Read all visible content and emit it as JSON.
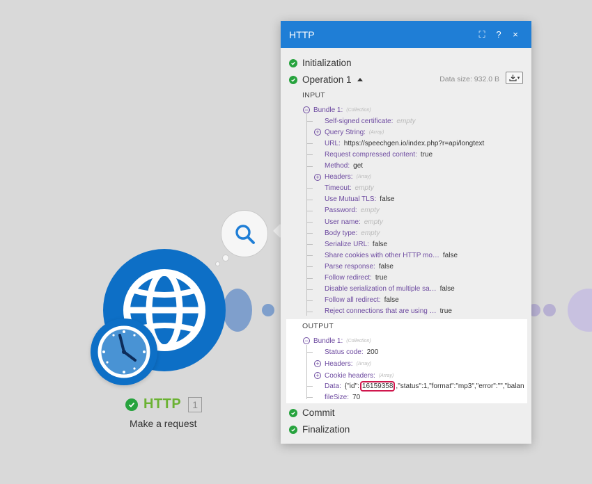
{
  "node": {
    "title": "HTTP",
    "number": "1",
    "subtitle": "Make a request"
  },
  "panel": {
    "title": "HTTP",
    "header_buttons": {
      "expand": "⛶",
      "help": "?",
      "close": "×"
    },
    "stages": {
      "initialization": "Initialization",
      "operation": "Operation 1",
      "commit": "Commit",
      "finalization": "Finalization"
    },
    "data_size": "Data size: 932.0 B",
    "input_label": "INPUT",
    "output_label": "OUTPUT",
    "input": {
      "bundle_key": "Bundle 1:",
      "bundle_type": "(Collection)",
      "rows": [
        {
          "key": "Self-signed certificate:",
          "value": "empty",
          "style": "e"
        },
        {
          "key": "Query String:",
          "value": "(Array)",
          "style": "t",
          "toggle": "+"
        },
        {
          "key": "URL:",
          "value": "https://speechgen.io/index.php?r=api/longtext",
          "style": "v"
        },
        {
          "key": "Request compressed content:",
          "value": "true",
          "style": "v"
        },
        {
          "key": "Method:",
          "value": "get",
          "style": "v"
        },
        {
          "key": "Headers:",
          "value": "(Array)",
          "style": "t",
          "toggle": "+"
        },
        {
          "key": "Timeout:",
          "value": "empty",
          "style": "e"
        },
        {
          "key": "Use Mutual TLS:",
          "value": "false",
          "style": "v"
        },
        {
          "key": "Password:",
          "value": "empty",
          "style": "e"
        },
        {
          "key": "User name:",
          "value": "empty",
          "style": "e"
        },
        {
          "key": "Body type:",
          "value": "empty",
          "style": "e"
        },
        {
          "key": "Serialize URL:",
          "value": "false",
          "style": "v"
        },
        {
          "key": "Share cookies with other HTTP mo…",
          "value": "false",
          "style": "v"
        },
        {
          "key": "Parse response:",
          "value": "false",
          "style": "v"
        },
        {
          "key": "Follow redirect:",
          "value": "true",
          "style": "v"
        },
        {
          "key": "Disable serialization of multiple sa…",
          "value": "false",
          "style": "v"
        },
        {
          "key": "Follow all redirect:",
          "value": "false",
          "style": "v"
        },
        {
          "key": "Reject connections that are using …",
          "value": "true",
          "style": "v"
        }
      ]
    },
    "output": {
      "bundle_key": "Bundle 1:",
      "bundle_type": "(Collection)",
      "status_key": "Status code:",
      "status_value": "200",
      "headers_key": "Headers:",
      "headers_type": "(Array)",
      "cookie_key": "Cookie headers:",
      "cookie_type": "(Array)",
      "data_key": "Data:",
      "data_prefix": "{\"id\":",
      "data_id": "16159358",
      "data_suffix": ",\"status\":1,\"format\":\"mp3\",\"error\":\"\",\"balan",
      "filesize_key": "fileSize:",
      "filesize_value": "70"
    }
  },
  "colors": {
    "header_blue": "#1f7ed6",
    "node_blue": "#0d6fc6",
    "success_green": "#27a33e",
    "title_green": "#6bb233",
    "highlight_red": "#d0174d",
    "key_purple": "#6d4aa0"
  }
}
